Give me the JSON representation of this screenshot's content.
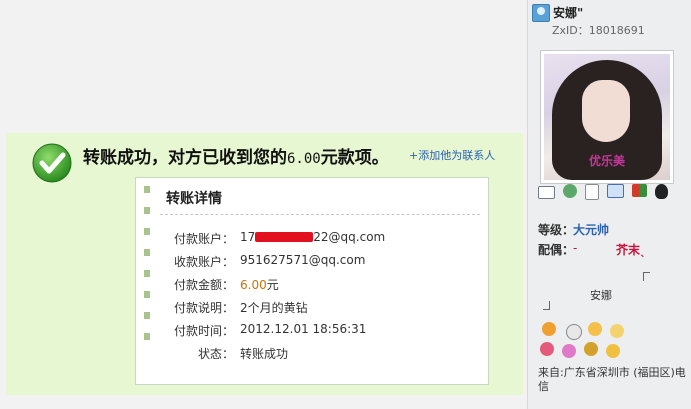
{
  "transfer": {
    "headline": "转账成功，对方已收到您的",
    "amount_display": "6.00",
    "headline_suffix": "元款项。",
    "add_contact": "+添加他为联系人",
    "details_title": "转账详情",
    "rows": [
      {
        "label": "付款账户：",
        "value_prefix": "17",
        "value_suffix": "22@qq.com"
      },
      {
        "label": "收款账户：",
        "value": "951627571@qq.com"
      },
      {
        "label": "付款金额：",
        "amount": "6.00",
        "unit": "元"
      },
      {
        "label": "付款说明：",
        "value": "2个月的黄钻"
      },
      {
        "label": "付款时间：",
        "value": "2012.12.01 18:56:31"
      },
      {
        "label": "状态：",
        "value": "转账成功"
      }
    ]
  },
  "profile": {
    "username": "安娜\"",
    "zxid": "ZxID：18018691",
    "avatar_caption": "优乐美",
    "rank_label": "等级：",
    "rank_value": "大元帅",
    "spouse_label": "配偶：",
    "spouse_dash": "-",
    "spouse_name": "芥末ˎ",
    "spouse_sign": "安娜",
    "origin": "来自:广东省深圳市 (福田区)电信",
    "actions": [
      "mail-icon",
      "add-friend-icon",
      "document-icon",
      "card-icon",
      "group-icon",
      "qq-icon"
    ]
  },
  "colors": {
    "success_green": "#3aa233",
    "panel_bg": "#e7f7d2",
    "link_blue": "#2b61b3",
    "amount_orange": "#c8720c",
    "mask_red": "#e2101e"
  }
}
